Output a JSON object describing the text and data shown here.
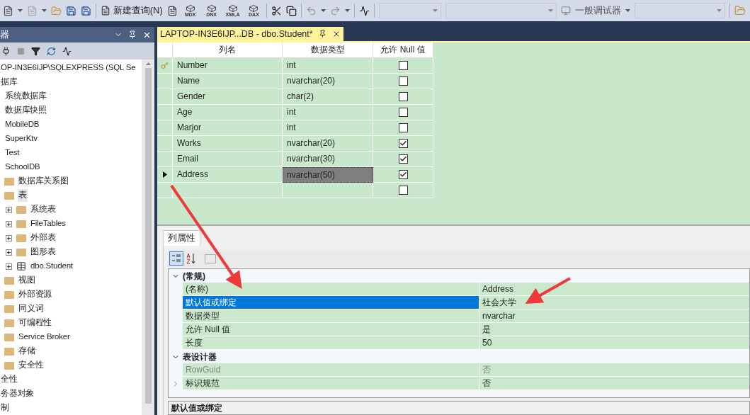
{
  "toolbar": {
    "new_query": "新建查询(N)",
    "query_icons": [
      "MDX",
      "DNX",
      "XMLA",
      "DAX"
    ],
    "debugger": "一般调试器"
  },
  "explorer": {
    "title": "器",
    "tree": [
      {
        "label": "OP-IN3E6IJP\\SQLEXPRESS (SQL Se",
        "kind": "plain",
        "selected": false
      },
      {
        "label": "据库",
        "kind": "plain",
        "selected": false,
        "children": [
          {
            "label": "系统数据库",
            "kind": "plain",
            "selected": false
          },
          {
            "label": "数据库快照",
            "kind": "plain",
            "selected": false
          },
          {
            "label": "MobileDB",
            "kind": "plain",
            "selected": false
          },
          {
            "label": "SuperKtv",
            "kind": "plain",
            "selected": false
          },
          {
            "label": "Test",
            "kind": "plain",
            "selected": false
          },
          {
            "label": "SchoolDB",
            "kind": "plain",
            "selected": false,
            "children": [
              {
                "label": "数据库关系图",
                "kind": "folder",
                "selected": false
              },
              {
                "label": "表",
                "kind": "folder",
                "selected": true,
                "children": [
                  {
                    "label": "系统表",
                    "kind": "folder",
                    "selected": false,
                    "expanded": false
                  },
                  {
                    "label": "FileTables",
                    "kind": "folder",
                    "selected": false,
                    "expanded": false
                  },
                  {
                    "label": "外部表",
                    "kind": "folder",
                    "selected": false,
                    "expanded": false
                  },
                  {
                    "label": "图形表",
                    "kind": "folder",
                    "selected": false,
                    "expanded": false
                  },
                  {
                    "label": "dbo.Student",
                    "kind": "table",
                    "selected": false,
                    "expanded": false
                  }
                ]
              },
              {
                "label": "视图",
                "kind": "folder",
                "selected": false
              },
              {
                "label": "外部资源",
                "kind": "folder",
                "selected": false
              },
              {
                "label": "同义词",
                "kind": "folder",
                "selected": false
              },
              {
                "label": "可编程性",
                "kind": "folder",
                "selected": false
              },
              {
                "label": "Service Broker",
                "kind": "folder",
                "selected": false
              },
              {
                "label": "存储",
                "kind": "folder",
                "selected": false
              },
              {
                "label": "安全性",
                "kind": "folder",
                "selected": false
              }
            ]
          }
        ]
      },
      {
        "label": "全性",
        "kind": "plain",
        "selected": false
      },
      {
        "label": "务器对象",
        "kind": "plain",
        "selected": false
      },
      {
        "label": "制",
        "kind": "plain",
        "selected": false
      }
    ]
  },
  "document_tab": {
    "title": "LAPTOP-IN3E6IJP...DB - dbo.Student*",
    "selected": true
  },
  "table": {
    "columns": [
      "列名",
      "数据类型",
      "允许 Null 值"
    ],
    "rows": [
      {
        "kind": "column",
        "name": "Number",
        "type": "int",
        "allow_null": false,
        "key": true,
        "current": false,
        "type_selected": false
      },
      {
        "kind": "column",
        "name": "Name",
        "type": "nvarchar(20)",
        "allow_null": false,
        "key": false,
        "current": false,
        "type_selected": false
      },
      {
        "kind": "column",
        "name": "Gender",
        "type": "char(2)",
        "allow_null": false,
        "key": false,
        "current": false,
        "type_selected": false
      },
      {
        "kind": "column",
        "name": "Age",
        "type": "int",
        "allow_null": false,
        "key": false,
        "current": false,
        "type_selected": false
      },
      {
        "kind": "column",
        "name": "Marjor",
        "type": "int",
        "allow_null": false,
        "key": false,
        "current": false,
        "type_selected": false
      },
      {
        "kind": "column",
        "name": "Works",
        "type": "nvarchar(20)",
        "allow_null": true,
        "key": false,
        "current": false,
        "type_selected": false
      },
      {
        "kind": "column",
        "name": "Email",
        "type": "nvarchar(30)",
        "allow_null": true,
        "key": false,
        "current": false,
        "type_selected": false
      },
      {
        "kind": "column",
        "name": "Address",
        "type": "nvarchar(50)",
        "allow_null": true,
        "key": false,
        "current": true,
        "type_selected": true
      },
      {
        "kind": "new",
        "allow_null": false,
        "key": false,
        "current": false,
        "type_selected": false
      }
    ]
  },
  "properties": {
    "tab": "列属性",
    "categories": [
      {
        "title": "(常规)",
        "expanded": true,
        "items": [
          {
            "label": "(名称)",
            "value": "Address",
            "kind": "plain",
            "disabled": false,
            "selected": false
          },
          {
            "label": "默认值或绑定",
            "value": "社会大学",
            "kind": "plain",
            "disabled": false,
            "selected": true
          },
          {
            "label": "数据类型",
            "value": "nvarchar",
            "kind": "plain",
            "disabled": false,
            "selected": false
          },
          {
            "label": "允许 Null 值",
            "value": "是",
            "kind": "plain",
            "disabled": false,
            "selected": false
          },
          {
            "label": "长度",
            "value": "50",
            "kind": "plain",
            "disabled": false,
            "selected": false
          }
        ]
      },
      {
        "title": "表设计器",
        "expanded": true,
        "items": [
          {
            "label": "RowGuid",
            "value": "否",
            "kind": "plain",
            "disabled": true,
            "selected": false
          },
          {
            "label": "标识规范",
            "value": "否",
            "kind": "expandable",
            "disabled": false,
            "selected": false
          }
        ]
      }
    ],
    "description": "默认值或绑定"
  }
}
